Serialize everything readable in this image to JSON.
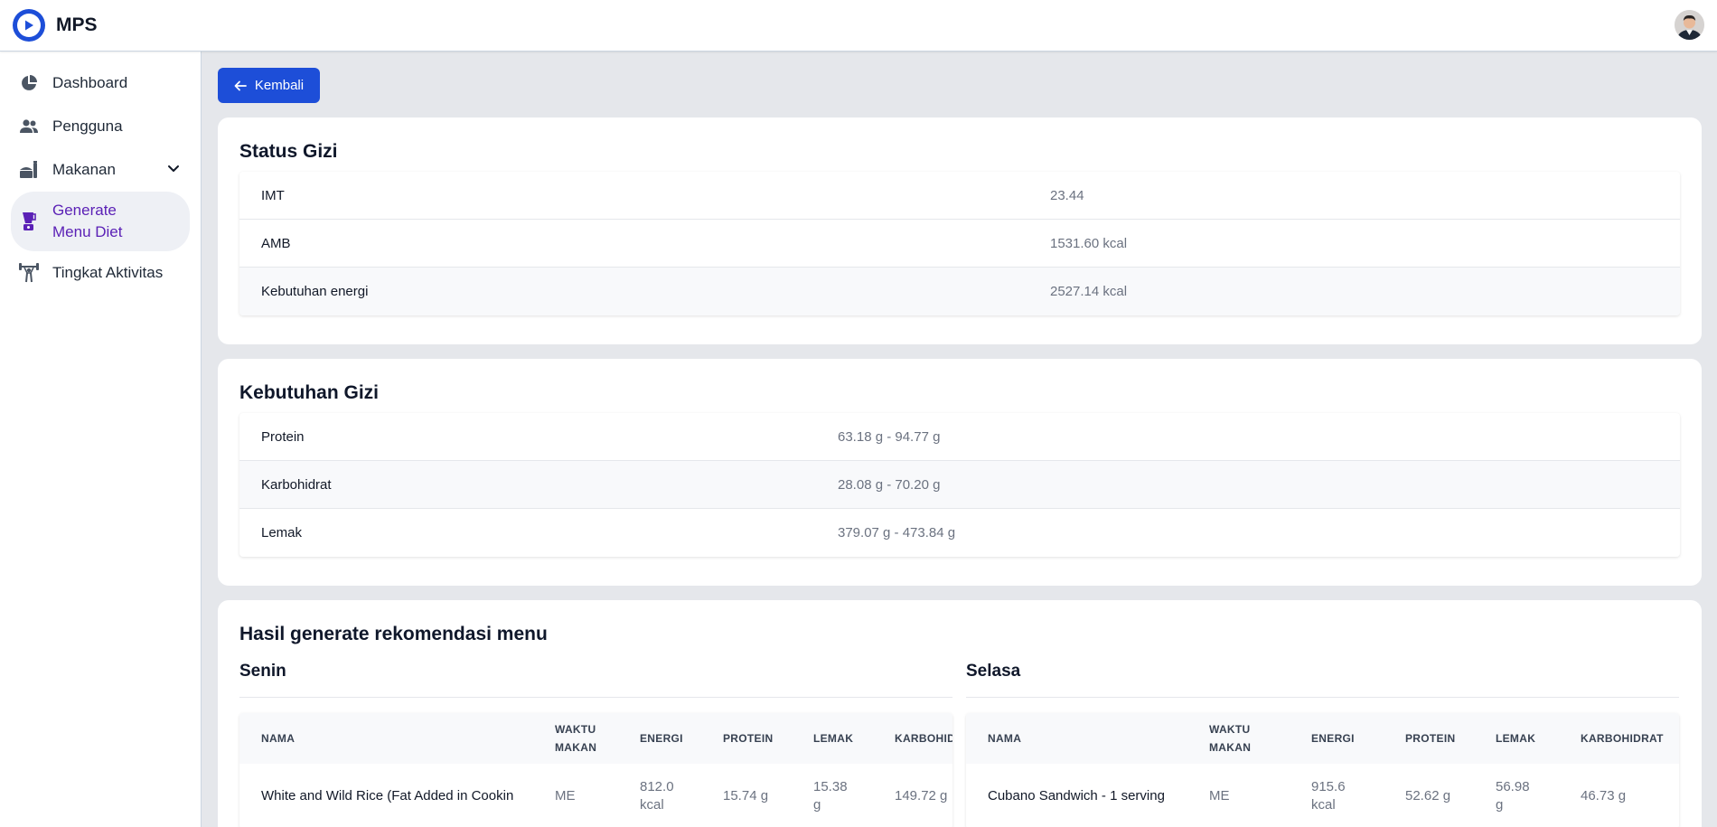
{
  "app": {
    "name": "MPS"
  },
  "colors": {
    "primary": "#1d4ed8",
    "active_nav": "#5b21b6"
  },
  "sidebar": {
    "items": [
      {
        "label": "Dashboard",
        "icon": "pie-chart-icon"
      },
      {
        "label": "Pengguna",
        "icon": "users-icon"
      },
      {
        "label": "Makanan",
        "icon": "food-icon",
        "expandable": true
      },
      {
        "label": "Generate Menu Diet",
        "icon": "blender-icon",
        "active": true
      },
      {
        "label": "Tingkat Aktivitas",
        "icon": "weightlifting-icon"
      }
    ]
  },
  "back_button": {
    "label": "Kembali"
  },
  "status_gizi": {
    "title": "Status Gizi",
    "rows": [
      {
        "label": "IMT",
        "value": "23.44"
      },
      {
        "label": "AMB",
        "value": "1531.60 kcal"
      },
      {
        "label": "Kebutuhan energi",
        "value": "2527.14 kcal"
      }
    ]
  },
  "kebutuhan_gizi": {
    "title": "Kebutuhan Gizi",
    "rows": [
      {
        "label": "Protein",
        "value": "63.18 g - 94.77 g"
      },
      {
        "label": "Karbohidrat",
        "value": "28.08 g - 70.20 g"
      },
      {
        "label": "Lemak",
        "value": "379.07 g - 473.84 g"
      }
    ]
  },
  "menu": {
    "title": "Hasil generate rekomendasi menu",
    "days": [
      {
        "name": "Senin",
        "headers": [
          "NAMA",
          "WAKTU MAKAN",
          "ENERGI",
          "PROTEIN",
          "LEMAK",
          "KARBOHIDRAT"
        ],
        "rows": [
          [
            "White and Wild Rice (Fat Added in Cookin",
            "ME",
            "812.0 kcal",
            "15.74 g",
            "15.38 g",
            "149.72 g"
          ]
        ]
      },
      {
        "name": "Selasa",
        "headers": [
          "NAMA",
          "WAKTU MAKAN",
          "ENERGI",
          "PROTEIN",
          "LEMAK",
          "KARBOHIDRAT"
        ],
        "rows": [
          [
            "Cubano Sandwich - 1 serving",
            "ME",
            "915.6 kcal",
            "52.62 g",
            "56.98 g",
            "46.73 g"
          ]
        ]
      }
    ]
  }
}
